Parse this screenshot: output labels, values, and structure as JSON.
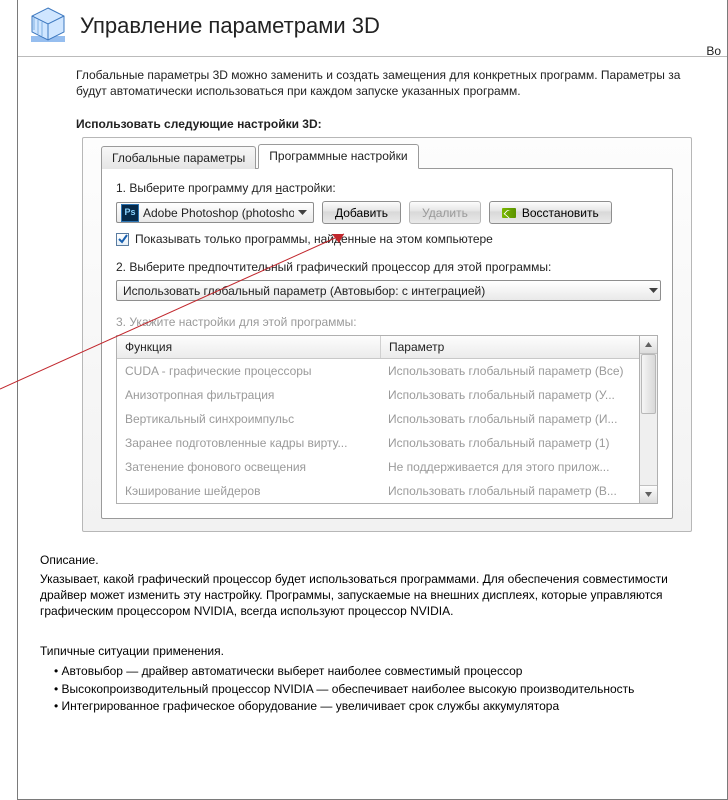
{
  "header": {
    "title": "Управление параметрами 3D",
    "right_link_fragment": "Во"
  },
  "intro": {
    "line1": "Глобальные параметры 3D можно заменить и создать замещения для конкретных программ. Параметры за",
    "line2": "будут автоматически использоваться при каждом запуске указанных программ."
  },
  "section_label": "Использовать следующие настройки 3D:",
  "tabs": {
    "global": "Глобальные параметры",
    "program": "Программные настройки"
  },
  "step1": {
    "label_prefix": "1. Выберите программу для ",
    "label_underlined": "н",
    "label_suffix": "астройки:",
    "program_icon_text": "Ps",
    "program_text": "Adobe Photoshop (photoshop....",
    "add_btn": "Добавить",
    "remove_btn": "Удалить",
    "restore_btn": "Восстановить",
    "checkbox_label": "Показывать только программы, найденные на этом компьютере"
  },
  "step2": {
    "label": "2. Выберите предпочтительный графический процессор для этой программы:",
    "combo_text": "Использовать глобальный параметр (Автовыбор: с интеграцией)"
  },
  "step3": {
    "label": "3. Укажите настройки для этой программы:",
    "col1": "Функция",
    "col2": "Параметр",
    "rows": [
      {
        "f": "CUDA - графические процессоры",
        "p": "Использовать глобальный параметр (Все)"
      },
      {
        "f": "Анизотропная фильтрация",
        "p": "Использовать глобальный параметр (У..."
      },
      {
        "f": "Вертикальный синхроимпульс",
        "p": "Использовать глобальный параметр (И..."
      },
      {
        "f": "Заранее подготовленные кадры вирту...",
        "p": "Использовать глобальный параметр (1)"
      },
      {
        "f": "Затенение фонового освещения",
        "p": "Не поддерживается для этого прилож..."
      },
      {
        "f": "Кэширование шейдеров",
        "p": "Использовать глобальный параметр (В..."
      }
    ]
  },
  "description": {
    "title": "Описание.",
    "body": "Указывает, какой графический процессор будет использоваться программами. Для обеспечения совместимости драйвер может изменить эту настройку. Программы, запускаемые на внешних дисплеях, которые управляются графическим процессором NVIDIA, всегда используют процессор NVIDIA."
  },
  "situations": {
    "title": "Типичные ситуации применения.",
    "items": [
      "Автовыбор — драйвер автоматически выберет наиболее совместимый процессор",
      "Высокопроизводительный процессор NVIDIA — обеспечивает наиболее высокую производительность",
      "Интегрированное графическое оборудование — увеличивает срок службы аккумулятора"
    ]
  }
}
